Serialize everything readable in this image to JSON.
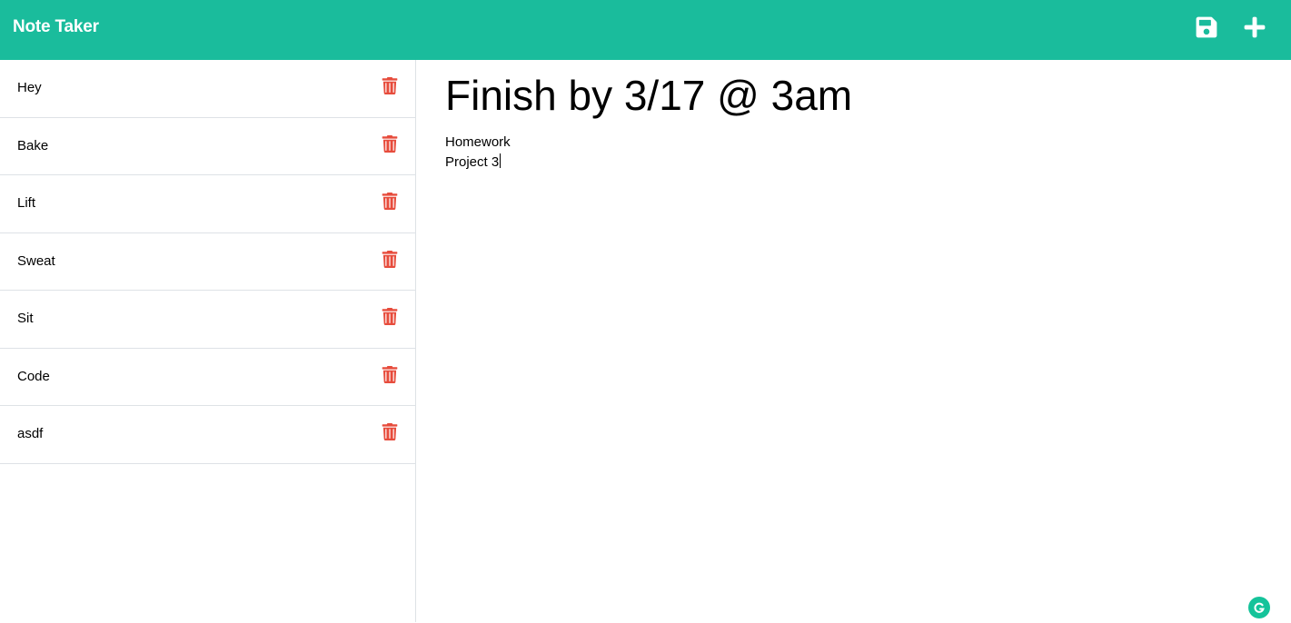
{
  "app": {
    "brand": "Note Taker",
    "accent_color": "#1abc9c",
    "delete_color": "#e74c3c"
  },
  "toolbar": {
    "save_icon": "save-icon",
    "new_icon": "plus-icon"
  },
  "notes": [
    {
      "title": "Hey"
    },
    {
      "title": "Bake"
    },
    {
      "title": "Lift"
    },
    {
      "title": "Sweat"
    },
    {
      "title": "Sit"
    },
    {
      "title": "Code"
    },
    {
      "title": "asdf"
    }
  ],
  "active_note": {
    "title": "Finish by 3/17 @ 3am",
    "text_lines": [
      "Homework",
      "Project 3"
    ]
  }
}
